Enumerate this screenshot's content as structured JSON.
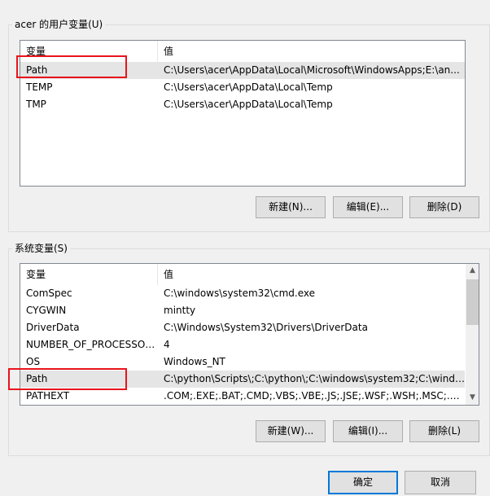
{
  "user_vars": {
    "title": "acer 的用户变量(U)",
    "col_var": "变量",
    "col_val": "值",
    "rows": [
      {
        "name": "Path",
        "value": "C:\\Users\\acer\\AppData\\Local\\Microsoft\\WindowsApps;E:\\an..."
      },
      {
        "name": "TEMP",
        "value": "C:\\Users\\acer\\AppData\\Local\\Temp"
      },
      {
        "name": "TMP",
        "value": "C:\\Users\\acer\\AppData\\Local\\Temp"
      }
    ],
    "selected_index": 0,
    "buttons": {
      "new": "新建(N)...",
      "edit": "编辑(E)...",
      "delete": "删除(D)"
    }
  },
  "system_vars": {
    "title": "系统变量(S)",
    "col_var": "变量",
    "col_val": "值",
    "rows": [
      {
        "name": "ComSpec",
        "value": "C:\\windows\\system32\\cmd.exe"
      },
      {
        "name": "CYGWIN",
        "value": "mintty"
      },
      {
        "name": "DriverData",
        "value": "C:\\Windows\\System32\\Drivers\\DriverData"
      },
      {
        "name": "NUMBER_OF_PROCESSORS",
        "value": "4"
      },
      {
        "name": "OS",
        "value": "Windows_NT"
      },
      {
        "name": "Path",
        "value": "C:\\python\\Scripts\\;C:\\python\\;C:\\windows\\system32;C:\\windo..."
      },
      {
        "name": "PATHEXT",
        "value": ".COM;.EXE;.BAT;.CMD;.VBS;.VBE;.JS;.JSE;.WSF;.WSH;.MSC;.PY;.P..."
      }
    ],
    "selected_index": 5,
    "buttons": {
      "new": "新建(W)...",
      "edit": "编辑(I)...",
      "delete": "删除(L)"
    }
  },
  "dialog_buttons": {
    "ok": "确定",
    "cancel": "取消"
  },
  "colors": {
    "highlight": "#e8141c",
    "selection": "#e5e5e5",
    "default_button_border": "#0078d7"
  },
  "icons": {
    "scroll_up": "▲",
    "scroll_down": "▼"
  }
}
